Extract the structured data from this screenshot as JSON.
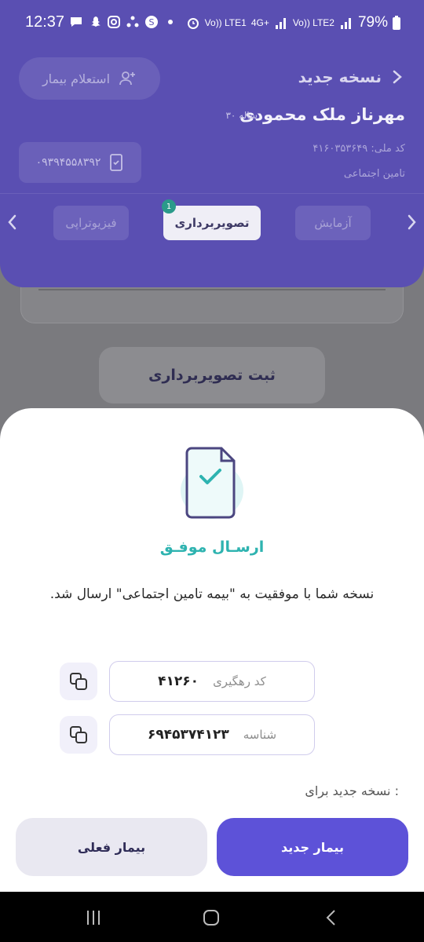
{
  "status_bar": {
    "time": "12:37",
    "network1": "Vo)) LTE1",
    "network2": "4G+",
    "network3": "Vo)) LTE2",
    "battery": "79%"
  },
  "header": {
    "title": "نسخه جدید",
    "inquiry_button": "استعلام بیمار",
    "patient_name": "مهرناز ملک محمودی",
    "patient_age": "۳۰ ساله",
    "phone": "۰۹۳۹۴۵۵۸۳۹۲",
    "national_code": "کد ملی: ۴۱۶۰۳۵۳۶۴۹",
    "insurer": "تامین اجتماعی",
    "tabs": [
      {
        "label": "آزمایش"
      },
      {
        "label": "تصویربرداری",
        "badge": "1"
      },
      {
        "label": "فیزیوتراپی"
      }
    ]
  },
  "content": {
    "submit_imaging": "ثبت تصویربرداری"
  },
  "sheet": {
    "title": "ارسـال موفـق",
    "message": "نسخه شما با موفقیت به \"بیمه تامین اجتماعی\" ارسال شد.",
    "tracking_label": "کد رهگیری",
    "tracking_value": "۴۱۲۶۰",
    "id_label": "شناسه",
    "id_value": "۶۹۴۵۳۷۴۱۲۳",
    "new_prescription_for": "نسخه جدید برای :",
    "current_patient_button": "بیمار فعلی",
    "new_patient_button": "بیمار جدید"
  },
  "colors": {
    "header_bg": "#5a4fb2",
    "accent_teal": "#2eb3b0",
    "primary_button": "#5d52d8"
  },
  "icons": {
    "back": "chevron-right-icon",
    "add_user": "add-user-icon",
    "phone": "phone-check-icon",
    "copy": "copy-icon",
    "document": "document-check-icon"
  }
}
